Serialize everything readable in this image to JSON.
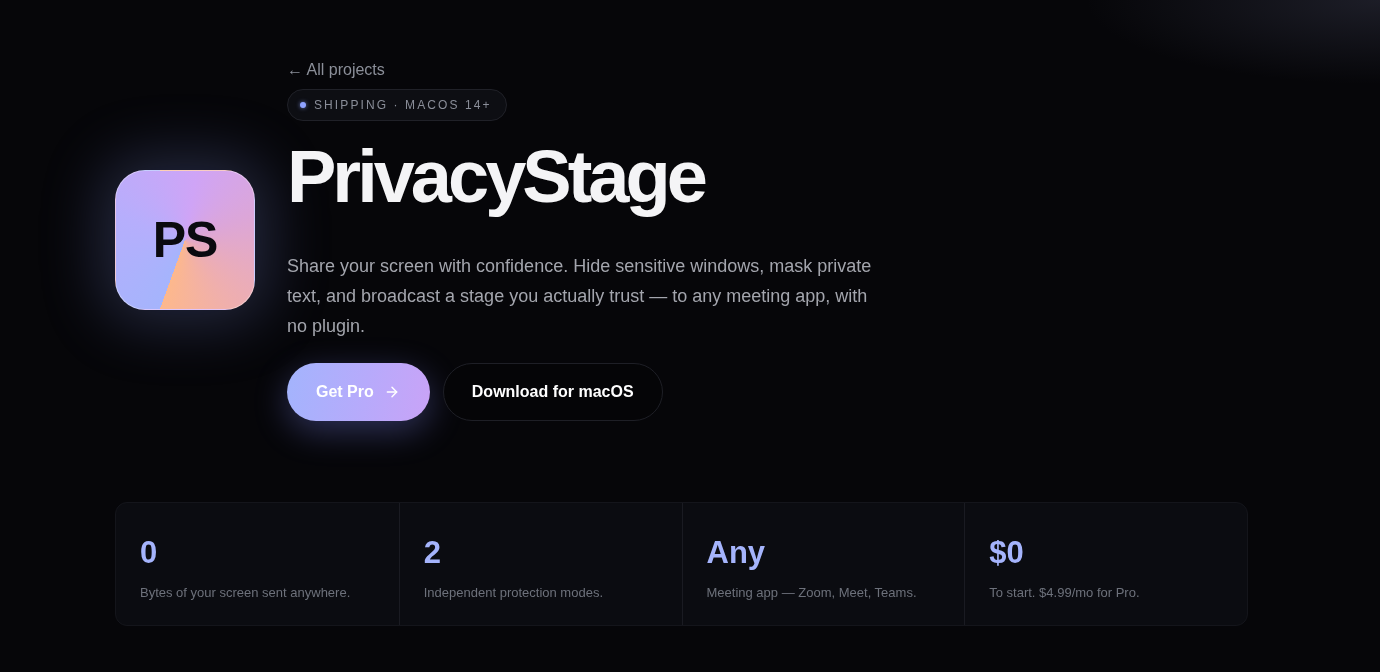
{
  "back_link": {
    "label": "← All projects"
  },
  "badge": {
    "label": "SHIPPING · MACOS 14+"
  },
  "app_icon": {
    "text": "PS"
  },
  "title": "PrivacyStage",
  "description": "Share your screen with confidence. Hide sensitive windows, mask private text, and broadcast a stage you actually trust — to any meeting app, with no plugin.",
  "buttons": [
    {
      "kind": "primary",
      "label": "Get Pro"
    },
    {
      "kind": "secondary",
      "label": "Download for macOS"
    }
  ],
  "stats": [
    {
      "value": "0",
      "label": "Bytes of your screen sent anywhere."
    },
    {
      "value": "2",
      "label": "Independent protection modes."
    },
    {
      "value": "Any",
      "label": "Meeting app — Zoom, Meet, Teams."
    },
    {
      "value": "$0",
      "label": "To start. $4.99/mo for Pro."
    }
  ]
}
